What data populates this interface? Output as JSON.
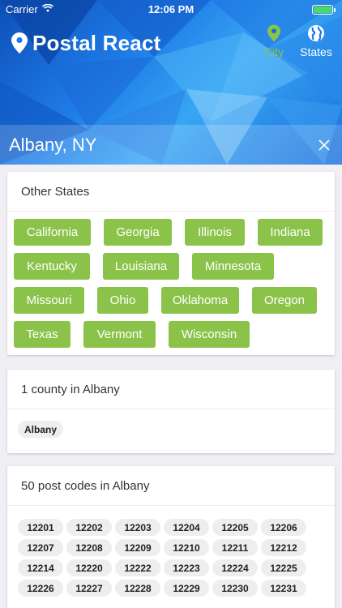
{
  "status_bar": {
    "carrier": "Carrier",
    "time": "12:06 PM",
    "battery_level": 1.0
  },
  "header": {
    "app_title": "Postal React",
    "icons": {
      "brand": "map-pin-icon",
      "city_tab": "location-pin-icon",
      "states_tab": "globe-icon",
      "close": "close-icon"
    },
    "tabs": [
      {
        "label": "City",
        "active": true
      },
      {
        "label": "States",
        "active": false
      }
    ],
    "location": "Albany, NY"
  },
  "colors": {
    "accent_green": "#8bc34a",
    "header_blue": "#1e7ae6"
  },
  "other_states": {
    "title": "Other States",
    "states": [
      "California",
      "Georgia",
      "Illinois",
      "Indiana",
      "Kentucky",
      "Louisiana",
      "Minnesota",
      "Missouri",
      "Ohio",
      "Oklahoma",
      "Oregon",
      "Texas",
      "Vermont",
      "Wisconsin"
    ]
  },
  "counties": {
    "title": "1 county in Albany",
    "items": [
      "Albany"
    ]
  },
  "post_codes": {
    "title": "50 post codes in Albany",
    "codes": [
      "12201",
      "12202",
      "12203",
      "12204",
      "12205",
      "12206",
      "12207",
      "12208",
      "12209",
      "12210",
      "12211",
      "12212",
      "12214",
      "12220",
      "12222",
      "12223",
      "12224",
      "12225",
      "12226",
      "12227",
      "12228",
      "12229",
      "12230",
      "12231"
    ]
  }
}
